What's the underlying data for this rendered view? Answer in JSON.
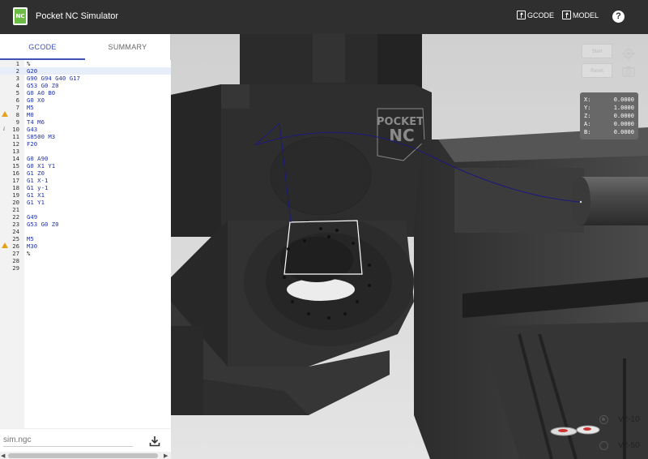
{
  "app": {
    "title": "Pocket NC Simulator",
    "logo_text": "NC"
  },
  "toolbar": {
    "gcode_label": "GCODE",
    "model_label": "MODEL",
    "help_label": "?"
  },
  "tabs": [
    {
      "label": "GCODE",
      "active": true
    },
    {
      "label": "SUMMARY",
      "active": false
    }
  ],
  "editor": {
    "lines": [
      {
        "n": "1",
        "code": "%",
        "plain": true
      },
      {
        "n": "2",
        "code": "G20"
      },
      {
        "n": "3",
        "code": "G90 G94 G40 G17"
      },
      {
        "n": "4",
        "code": "G53 G0 Z0"
      },
      {
        "n": "5",
        "code": "G0 A0 B0"
      },
      {
        "n": "6",
        "code": "G0 X0"
      },
      {
        "n": "7",
        "code": "M5"
      },
      {
        "n": "8",
        "code": "M0",
        "marker": "warning-icon"
      },
      {
        "n": "9",
        "code": "T4 M6"
      },
      {
        "n": "10",
        "code": "G43",
        "marker": "info-icon"
      },
      {
        "n": "11",
        "code": "S8500 M3"
      },
      {
        "n": "12",
        "code": "F20"
      },
      {
        "n": "13",
        "code": ""
      },
      {
        "n": "14",
        "code": "G0 A90"
      },
      {
        "n": "15",
        "code": "G0 X1 Y1"
      },
      {
        "n": "16",
        "code": "G1 Z0"
      },
      {
        "n": "17",
        "code": "G1 X-1"
      },
      {
        "n": "18",
        "code": "G1 y-1"
      },
      {
        "n": "19",
        "code": "G1 X1"
      },
      {
        "n": "20",
        "code": "G1 Y1"
      },
      {
        "n": "21",
        "code": ""
      },
      {
        "n": "22",
        "code": "G49"
      },
      {
        "n": "23",
        "code": "G53 G0 Z0"
      },
      {
        "n": "24",
        "code": ""
      },
      {
        "n": "25",
        "code": "M5"
      },
      {
        "n": "26",
        "code": "M30",
        "marker": "warning-icon"
      },
      {
        "n": "27",
        "code": "%",
        "plain": true
      },
      {
        "n": "28",
        "code": ""
      },
      {
        "n": "29",
        "code": ""
      }
    ]
  },
  "file": {
    "placeholder": "sim.ngc"
  },
  "viewport": {
    "ghost_buttons": [
      "Start",
      "Reset"
    ],
    "coords": [
      {
        "axis": "X:",
        "value": "0.0000"
      },
      {
        "axis": "Y:",
        "value": "1.0000"
      },
      {
        "axis": "Z:",
        "value": "0.0000"
      },
      {
        "axis": "A:",
        "value": "0.0000"
      },
      {
        "axis": "B:",
        "value": "0.0000"
      }
    ],
    "model_options": [
      {
        "label": "V2-10",
        "selected": true
      },
      {
        "label": "V2-50",
        "selected": false
      }
    ],
    "brand_text": [
      "POCKET",
      "NC"
    ]
  },
  "colors": {
    "accent": "#3f51b5",
    "appbar": "#2f2f2f",
    "logo": "#6cbd45",
    "warning": "#e3a21a",
    "toolpath": "#1c1a7a"
  }
}
